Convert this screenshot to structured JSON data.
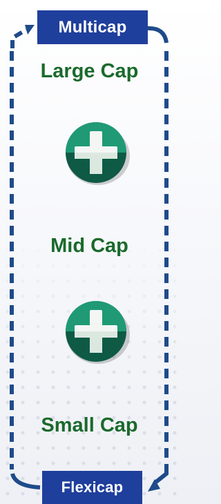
{
  "tags": {
    "top": "Multicap",
    "bottom": "Flexicap"
  },
  "caps": {
    "large": "Large Cap",
    "mid": "Mid Cap",
    "small": "Small Cap"
  },
  "icons": {
    "add": "plus-icon",
    "cycle_arrow": "arrow-head-icon"
  },
  "colors": {
    "tag_bg": "#1f3f9c",
    "frame": "#1f4b8a",
    "label_text": "#1a6a2c",
    "icon_teal": "#1f9a74",
    "icon_dark": "#0e5a45"
  }
}
